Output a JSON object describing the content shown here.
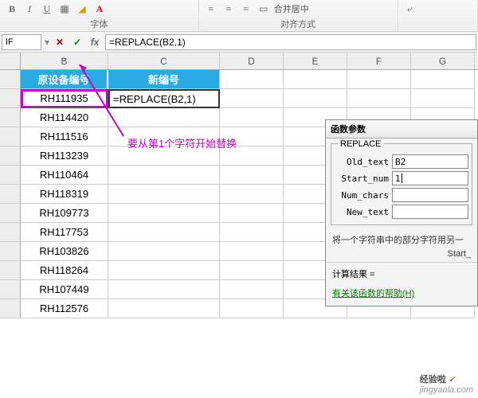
{
  "ribbon": {
    "font_label": "字体",
    "align_label": "对齐方式",
    "merge_label": "合并居中",
    "wrap_label": "自动换行"
  },
  "formula_bar": {
    "namebox": "IF",
    "formula": "=REPLACE(B2,1)"
  },
  "columns": [
    "B",
    "C",
    "D",
    "E",
    "F",
    "G"
  ],
  "headers": {
    "b": "原设备编号",
    "c": "新编号"
  },
  "cells": {
    "c2": "=REPLACE(B2,1)"
  },
  "col_b": [
    "RH111935",
    "RH114420",
    "RH111516",
    "RH113239",
    "RH110464",
    "RH118319",
    "RH109773",
    "RH117753",
    "RH103826",
    "RH118264",
    "RH107449",
    "RH112576"
  ],
  "annotation": "要从第1个字符开始替换",
  "dialog": {
    "title": "函数参数",
    "legend": "REPLACE",
    "params": {
      "old_text_label": "Old_text",
      "old_text_value": "B2",
      "start_num_label": "Start_num",
      "start_num_value": "1",
      "num_chars_label": "Num_chars",
      "num_chars_value": "",
      "new_text_label": "New_text",
      "new_text_value": ""
    },
    "desc1": "将一个字符串中的部分字符用另一",
    "desc2": "Start_",
    "result_label": "计算结果 =",
    "help": "有关该函数的帮助(H)"
  },
  "watermark": {
    "text": "经验啦",
    "check": "✓",
    "url": "jingyanla.com"
  }
}
